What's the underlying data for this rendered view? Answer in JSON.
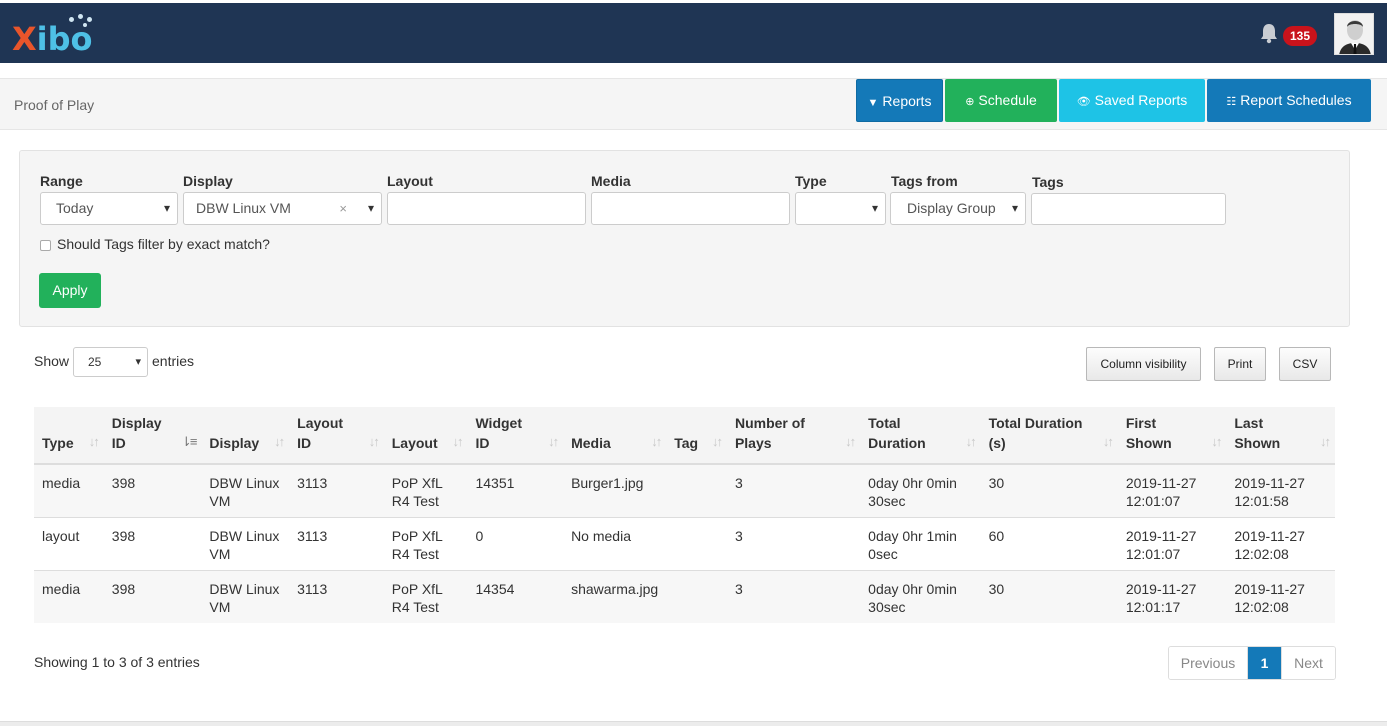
{
  "app": {
    "logo_x": "X",
    "logo_rest": "ibo"
  },
  "header": {
    "notification_count": "135"
  },
  "subheader": {
    "title": "Proof of Play",
    "buttons": {
      "reports": "Reports",
      "schedule": "Schedule",
      "saved_reports": "Saved Reports",
      "report_schedules": "Report Schedules"
    }
  },
  "filters": {
    "range": {
      "label": "Range",
      "value": "Today"
    },
    "display": {
      "label": "Display",
      "value": "DBW Linux VM",
      "clear": "×"
    },
    "layout": {
      "label": "Layout",
      "value": ""
    },
    "media": {
      "label": "Media",
      "value": ""
    },
    "type": {
      "label": "Type",
      "value": ""
    },
    "tags_from": {
      "label": "Tags from",
      "value": "Display Group"
    },
    "tags": {
      "label": "Tags",
      "value": ""
    },
    "exact_match_label": "Should Tags filter by exact match?",
    "apply": "Apply"
  },
  "table_controls": {
    "show": "Show",
    "page_length": "25",
    "entries": "entries",
    "column_visibility": "Column visibility",
    "print": "Print",
    "csv": "CSV"
  },
  "table": {
    "columns": [
      [
        "Type"
      ],
      [
        "Display",
        "ID"
      ],
      [
        "Display"
      ],
      [
        "Layout",
        "ID"
      ],
      [
        "Layout"
      ],
      [
        "Widget",
        "ID"
      ],
      [
        "Media"
      ],
      [
        "Tag"
      ],
      [
        "Number of",
        "Plays"
      ],
      [
        "Total",
        "Duration"
      ],
      [
        "Total Duration",
        "(s)"
      ],
      [
        "First",
        "Shown"
      ],
      [
        "Last",
        "Shown"
      ]
    ],
    "rows": [
      [
        "media",
        "398",
        "DBW Linux VM",
        "3113",
        "PoP XfL R4 Test",
        "14351",
        "Burger1.jpg",
        "",
        "3",
        "0day 0hr 0min 30sec",
        "30",
        "2019-11-27 12:01:07",
        "2019-11-27 12:01:58"
      ],
      [
        "layout",
        "398",
        "DBW Linux VM",
        "3113",
        "PoP XfL R4 Test",
        "0",
        "No media",
        "",
        "3",
        "0day 0hr 1min 0sec",
        "60",
        "2019-11-27 12:01:07",
        "2019-11-27 12:02:08"
      ],
      [
        "media",
        "398",
        "DBW Linux VM",
        "3113",
        "PoP XfL R4 Test",
        "14354",
        "shawarma.jpg",
        "",
        "3",
        "0day 0hr 0min 30sec",
        "30",
        "2019-11-27 12:01:17",
        "2019-11-27 12:02:08"
      ]
    ]
  },
  "pagination": {
    "info": "Showing 1 to 3 of 3 entries",
    "previous": "Previous",
    "current": "1",
    "next": "Next"
  }
}
